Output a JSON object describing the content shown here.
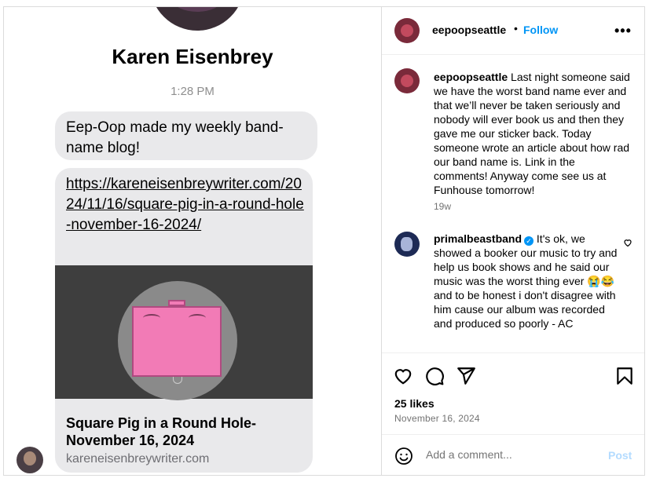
{
  "messages": {
    "contact_name": "Karen Eisenbrey",
    "time": "1:28 PM",
    "bubble_text": "Eep-Oop made my weekly band-name blog!",
    "link": {
      "url": "https://kareneisenbreywriter.com/2024/11/16/square-pig-in-a-round-hole-november-16-2024/",
      "title": "Square Pig in a Round Hole- November 16, 2024",
      "domain": "kareneisenbreywriter.com"
    }
  },
  "post": {
    "header": {
      "username": "eepoopseattle",
      "separator": "•",
      "follow_label": "Follow",
      "more_label": "•••"
    },
    "caption": {
      "username": "eepoopseattle",
      "text": "Last night someone said we have the worst band name ever and that we’ll never be taken seriously and nobody will ever book us and then they gave me our sticker back. Today someone wrote an article about how rad our band name is. Link in the comments! Anyway come see us at Funhouse tomorrow!",
      "timestamp": "19w"
    },
    "comment": {
      "username": "primalbeastband",
      "verified": "✓",
      "text": "It's ok, we showed a booker our music to try and help us book shows and he said our music was the worst thing ever 😭😂 and to be honest i don't disagree with him cause our album was recorded and produced so poorly - AC"
    },
    "likes": "25 likes",
    "date": "November 16, 2024",
    "add_comment_placeholder": "Add a comment...",
    "post_label": "Post"
  },
  "colors": {
    "accent": "#0095f6",
    "bubble": "#e9e9eb",
    "pig": "#f27bb6",
    "muted": "#737373"
  },
  "icons": [
    "heart-icon",
    "comment-icon",
    "share-icon",
    "bookmark-icon",
    "emoji-icon",
    "more-icon",
    "verified-icon"
  ]
}
